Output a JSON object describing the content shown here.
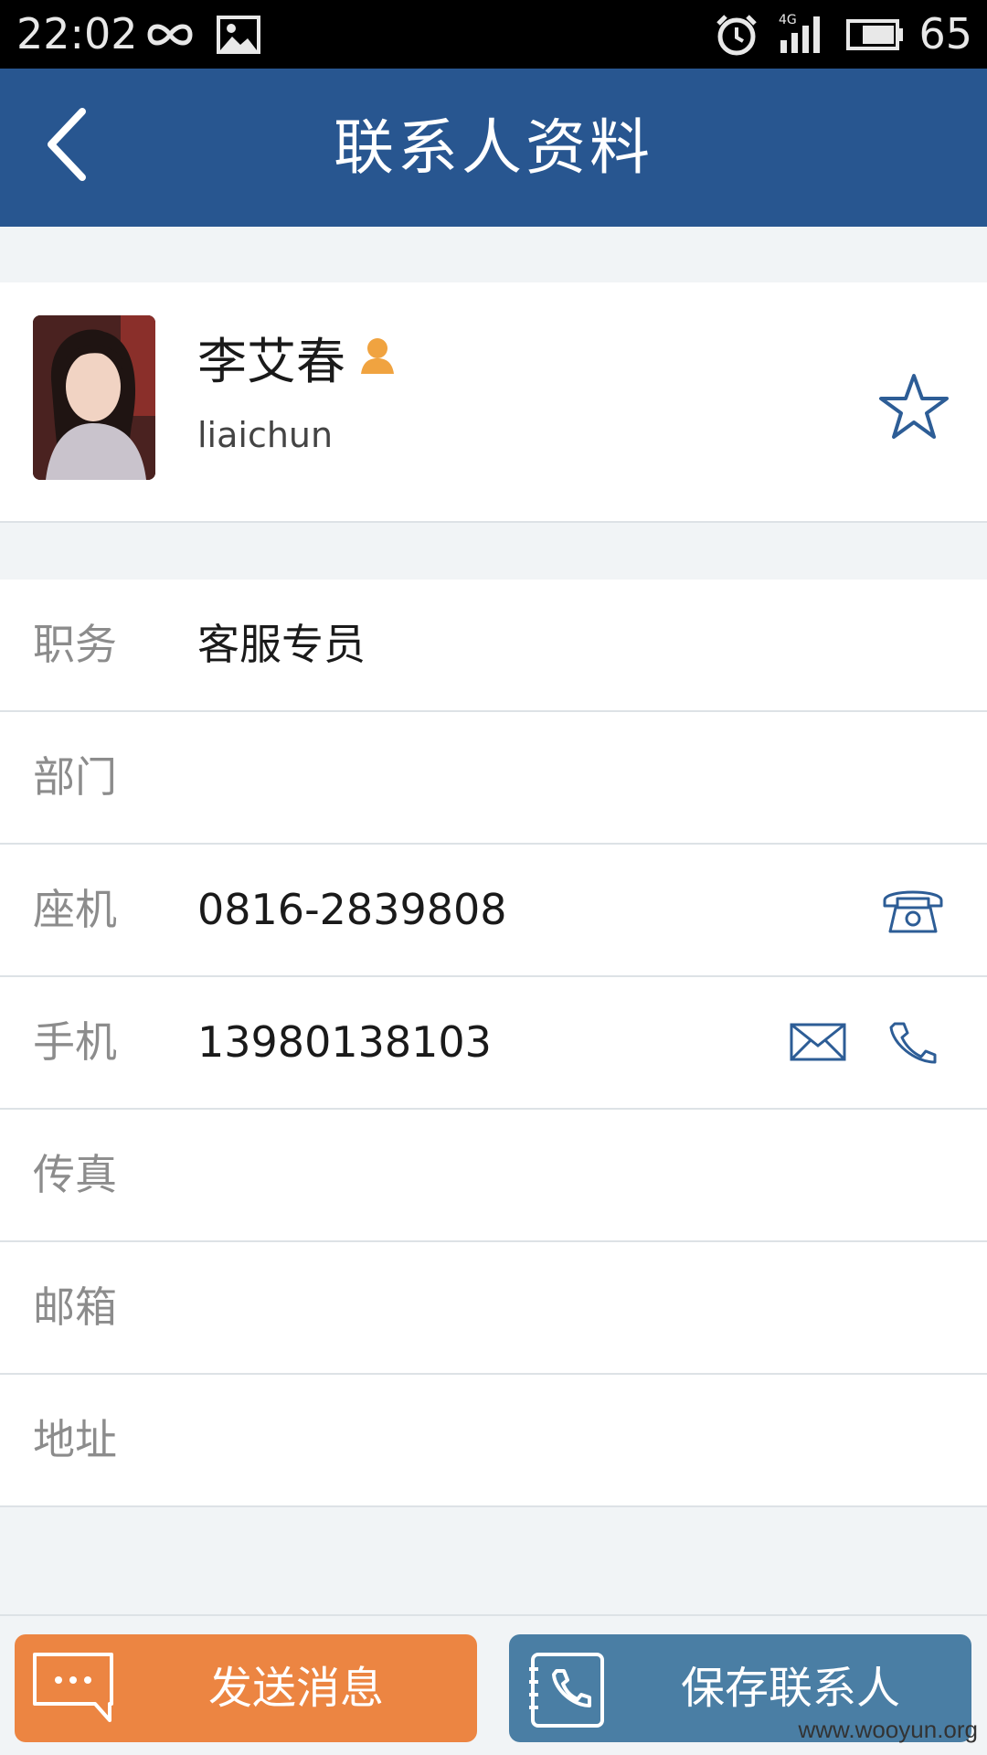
{
  "status_bar": {
    "time": "22:02",
    "battery": "65",
    "icons": [
      "infinity-icon",
      "image-icon",
      "alarm-icon",
      "signal-4g-icon",
      "battery-icon"
    ]
  },
  "header": {
    "title": "联系人资料",
    "back_icon": "chevron-left-icon"
  },
  "profile": {
    "name": "李艾春",
    "username": "liaichun",
    "favorite_icon": "star-outline-icon"
  },
  "fields": [
    {
      "label": "职务",
      "value": "客服专员"
    },
    {
      "label": "部门",
      "value": ""
    },
    {
      "label": "座机",
      "value": "0816-2839808"
    },
    {
      "label": "手机",
      "value": "13980138103"
    },
    {
      "label": "传真",
      "value": ""
    },
    {
      "label": "邮箱",
      "value": ""
    },
    {
      "label": "地址",
      "value": ""
    }
  ],
  "actions": {
    "send_message": "发送消息",
    "save_contact": "保存联系人"
  },
  "colors": {
    "header": "#285690",
    "send_button": "#ec8542",
    "save_button": "#4a7ea4",
    "icon": "#2d5d96",
    "person_badge": "#f0a340"
  },
  "watermark": "www.wooyun.org"
}
